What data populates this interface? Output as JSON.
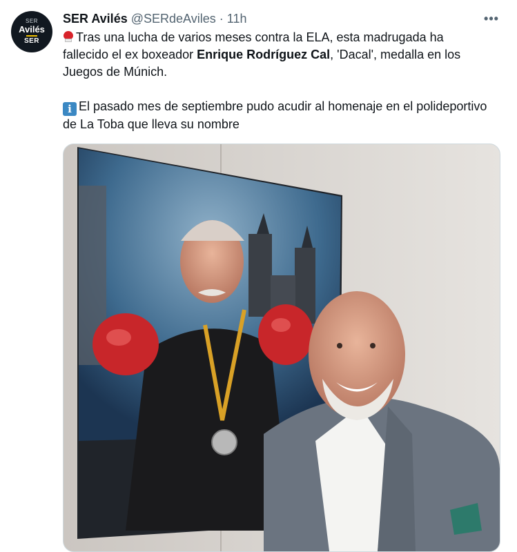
{
  "account": {
    "avatar_line1": "SER",
    "avatar_line2": "Avilés",
    "avatar_line3": "SER",
    "name": "SER Avilés",
    "handle": "@SERdeAviles",
    "separator": "·",
    "time": "11h"
  },
  "tweet": {
    "para1": {
      "before": "Tras una lucha de varios meses contra la ELA, esta madrugada ha fallecido el ex boxeador ",
      "bold": "Enrique Rodríguez Cal",
      "after": ", 'Dacal', medalla en los Juegos de Múnich."
    },
    "para2": "El pasado mes de septiembre pudo acudir al homenaje en el polideportivo de La Toba que lleva su nombre"
  },
  "icons": {
    "more": "more-horizontal-icon",
    "boxing": "boxing-glove-icon",
    "info": "information-icon"
  },
  "colors": {
    "text": "#0f1419",
    "secondary": "#536471",
    "info_blue": "#3b88c3",
    "glove_red": "#d8232a"
  }
}
